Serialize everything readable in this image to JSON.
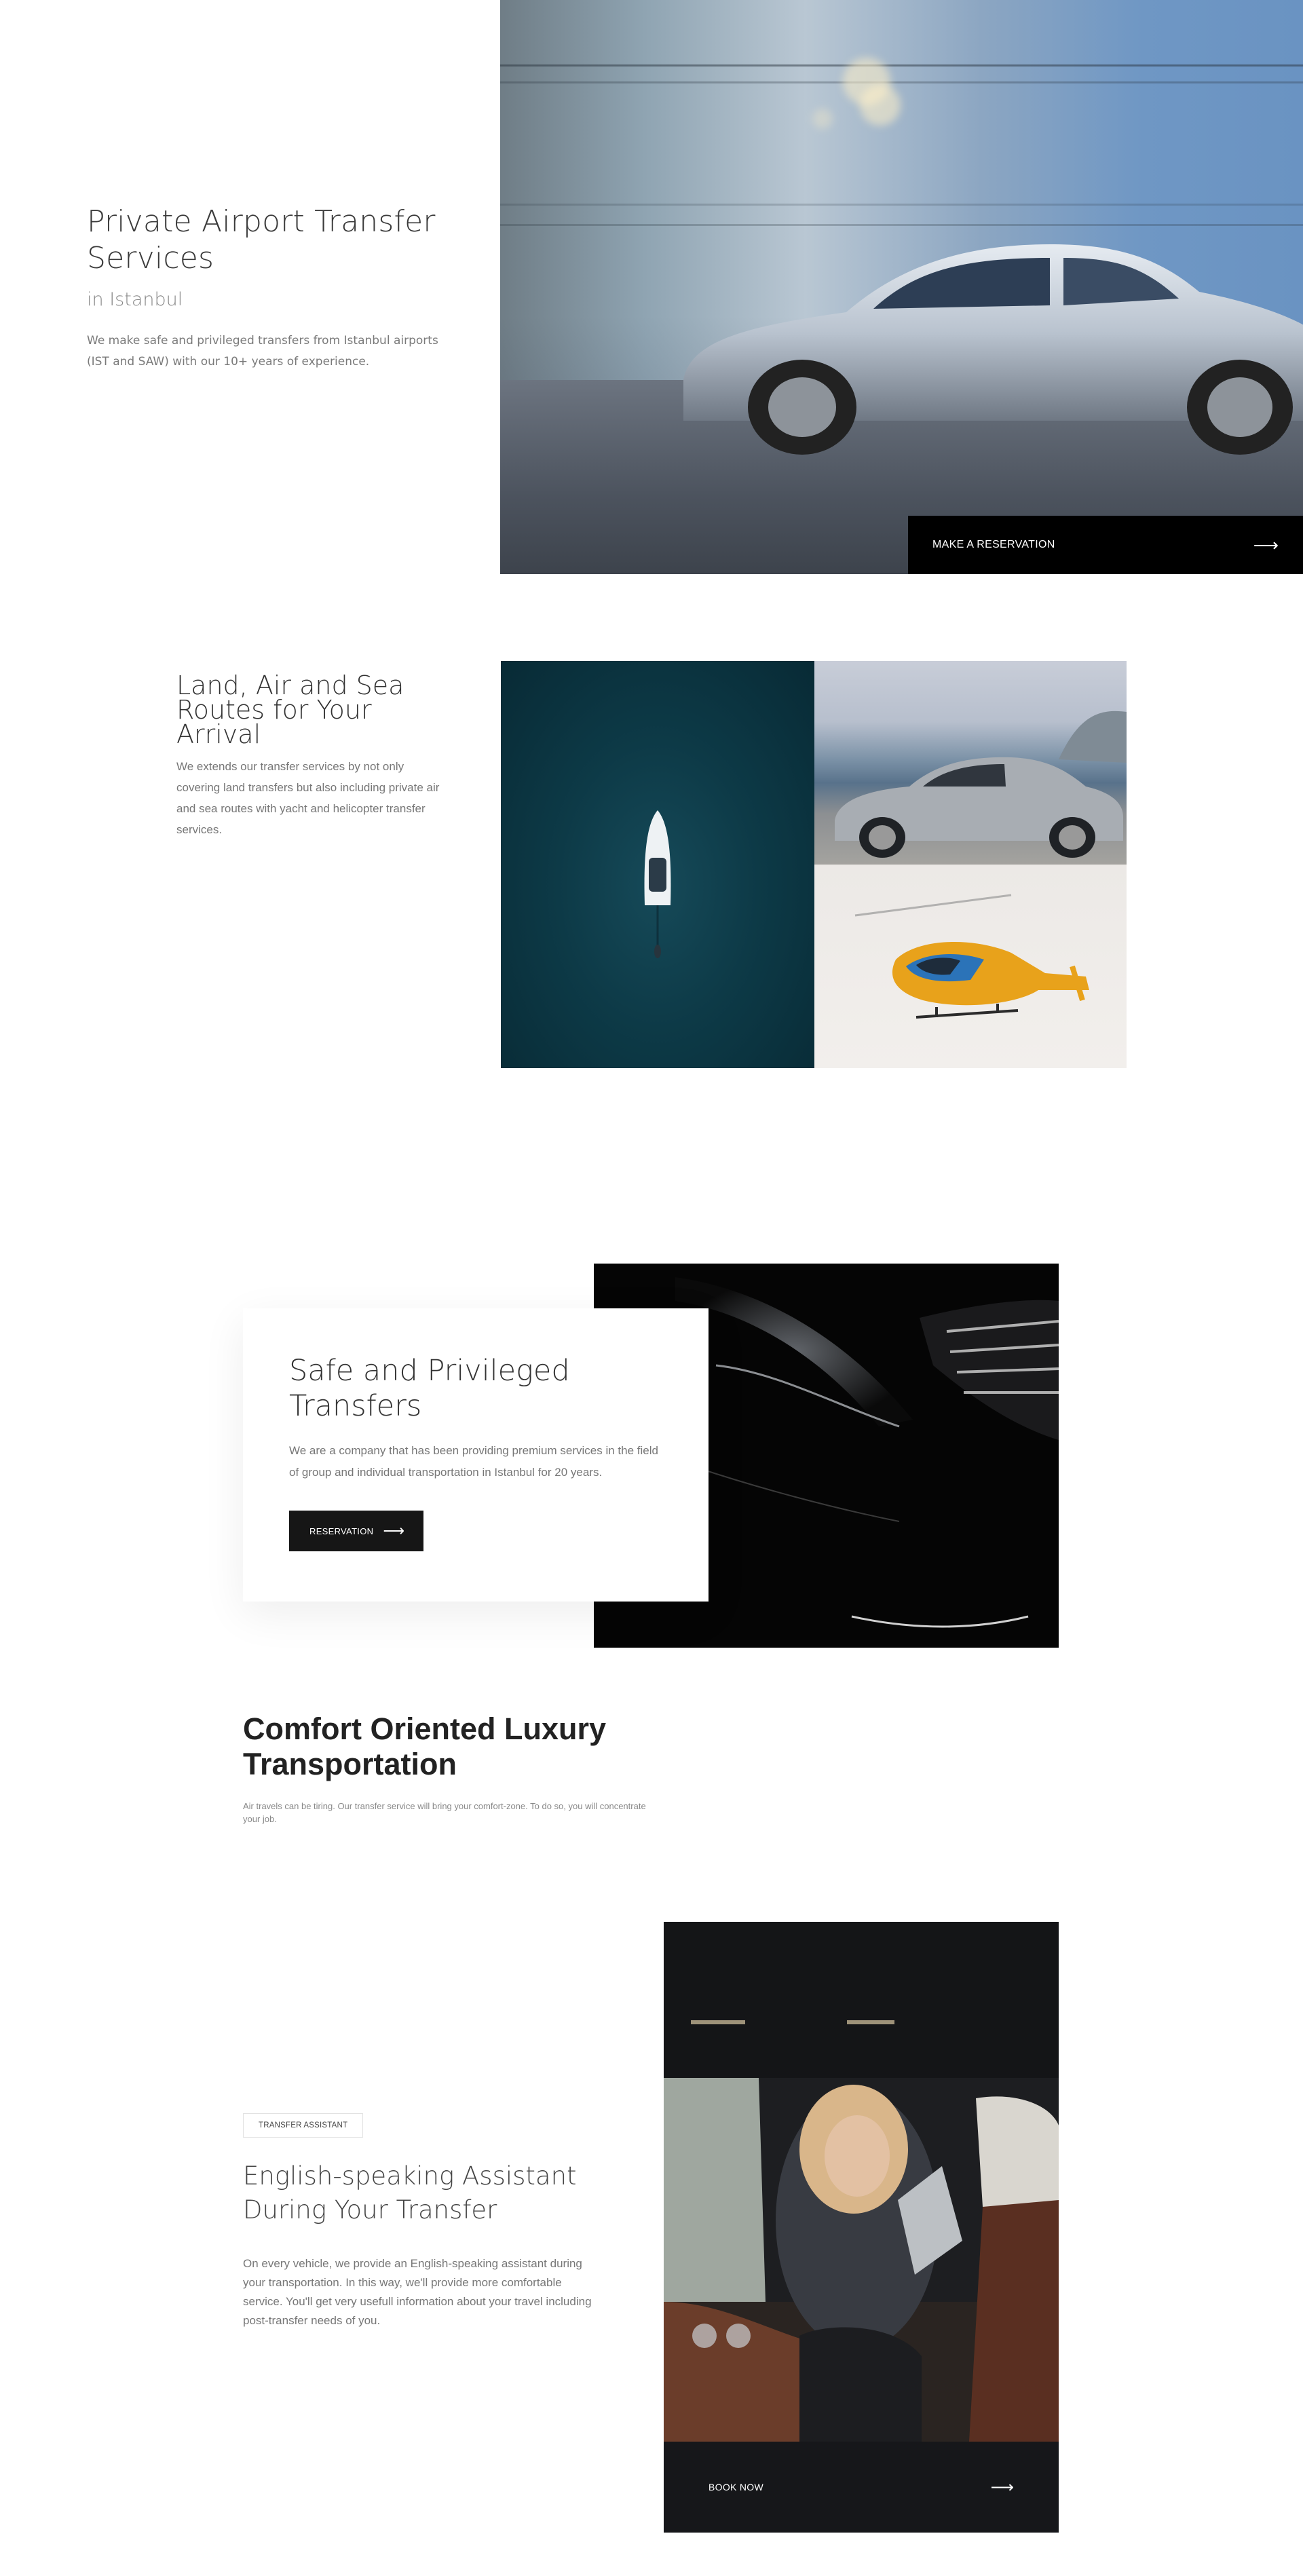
{
  "hero": {
    "title": "Private Airport Transfer Services",
    "subtitle": "in Istanbul",
    "description": "We make safe and privileged transfers from Istanbul airports (IST and SAW) with our 10+ years of experience.",
    "cta_label": "MAKE A RESERVATION",
    "cta_icon": "arrow-right-icon"
  },
  "routes": {
    "title": "Land, Air and Sea Routes for Your Arrival",
    "description": "We extends our transfer services by not only covering land transfers but also including private air and sea routes with yacht and helicopter transfer services."
  },
  "safe": {
    "title": "Safe and Privileged Transfers",
    "description": "We are a company that has been providing premium services in the field of group and individual transportation in Istanbul for 20 years.",
    "button_label": "RESERVATION",
    "button_icon": "arrow-right-icon"
  },
  "comfort": {
    "title": "Comfort Oriented Luxury Transportation",
    "description": "Air travels can be tiring. Our transfer service will bring your comfort-zone. To do so, you will concentrate your job."
  },
  "assistant": {
    "badge": "TRANSFER ASSISTANT",
    "title": "English-speaking Assistant During Your Transfer",
    "description": "On every vehicle, we provide an English-speaking assistant during your transportation. In this way, we'll provide more comfortable service. You'll get very usefull information about your travel including post-transfer needs of you.",
    "book_label": "BOOK NOW",
    "book_icon": "arrow-right-icon"
  },
  "colors": {
    "dark": "#000000",
    "button_dark": "#161616",
    "text_gray": "#777777"
  }
}
